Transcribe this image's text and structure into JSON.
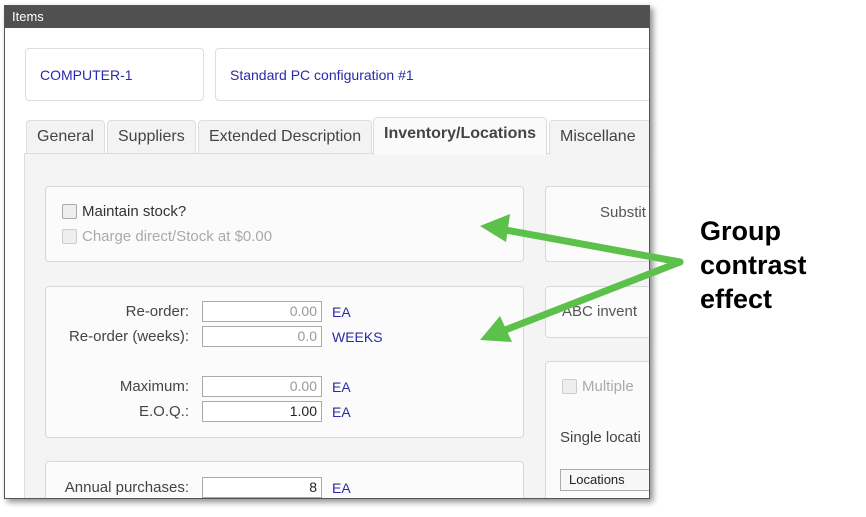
{
  "window": {
    "title": "Items"
  },
  "header": {
    "item_code": "COMPUTER-1",
    "description": "Standard PC configuration #1"
  },
  "tabs": [
    {
      "label": "General"
    },
    {
      "label": "Suppliers"
    },
    {
      "label": "Extended Description"
    },
    {
      "label": "Inventory/Locations",
      "active": true
    },
    {
      "label": "Miscellane"
    }
  ],
  "stock": {
    "maintain_label": "Maintain stock?",
    "maintain_checked": false,
    "charge_label": "Charge direct/Stock at $0.00",
    "charge_disabled": true
  },
  "reorder": {
    "reorder_label": "Re-order:",
    "reorder_value": "0.00",
    "reorder_unit": "EA",
    "weeks_label": "Re-order (weeks):",
    "weeks_value": "0.0",
    "weeks_unit": "WEEKS",
    "max_label": "Maximum:",
    "max_value": "0.00",
    "max_unit": "EA",
    "eoq_label": "E.O.Q.:",
    "eoq_value": "1.00",
    "eoq_unit": "EA"
  },
  "annual": {
    "label": "Annual purchases:",
    "value": "8",
    "unit": "EA"
  },
  "right": {
    "substitute_label": "Substit",
    "abc_label": "ABC invent",
    "multiple_label": "Multiple",
    "single_label": "Single locati",
    "locations_button": "Locations"
  },
  "annotation": {
    "text_lines": [
      "Group",
      "contrast",
      "effect"
    ],
    "arrow_color": "#5cc14a"
  }
}
